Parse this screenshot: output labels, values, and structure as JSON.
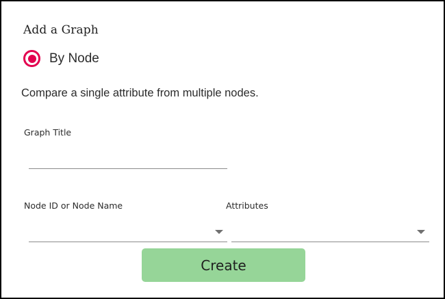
{
  "dialog": {
    "title": "Add a Graph",
    "graph_type": {
      "label": "By Node",
      "selected": true,
      "icon": "radio-selected-icon"
    },
    "description": "Compare a single attribute from multiple nodes.",
    "graph_title_field": {
      "label": "Graph Title",
      "value": "",
      "placeholder": ""
    },
    "node_field": {
      "label": "Node ID or Node Name",
      "value": "",
      "icon": "chevron-down-icon"
    },
    "attributes_field": {
      "label": "Attributes",
      "value": "",
      "icon": "chevron-down-icon"
    },
    "create_label": "Create"
  },
  "colors": {
    "radio_accent": "#e3004f",
    "create_button_bg": "#96d598",
    "border": "#000000"
  }
}
